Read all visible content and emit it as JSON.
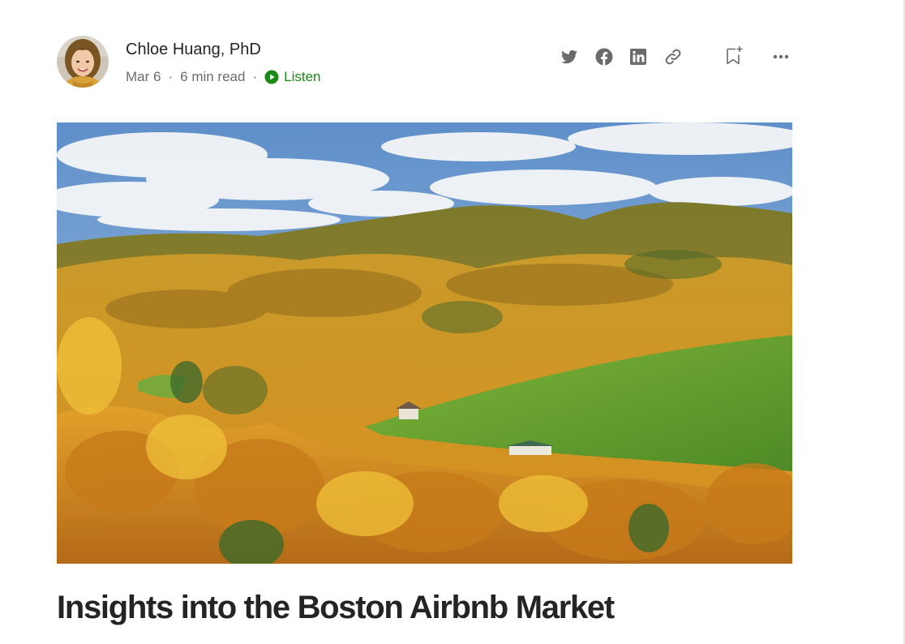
{
  "author": {
    "name": "Chloe Huang, PhD",
    "avatar_icon": "profile-photo"
  },
  "meta": {
    "date": "Mar 6",
    "separator": "·",
    "read_time": "6 min read",
    "listen_label": "Listen",
    "listen_icon": "play-circle-icon"
  },
  "share": {
    "icons": [
      "twitter-icon",
      "facebook-icon",
      "linkedin-icon",
      "link-icon"
    ]
  },
  "toolbar": {
    "bookmark_icon": "bookmark-add-icon",
    "more_icon": "more-horizontal-icon"
  },
  "hero": {
    "image_icon": "autumn-landscape-photo"
  },
  "article": {
    "title": "Insights into the Boston Airbnb Market"
  },
  "colors": {
    "text": "#242424",
    "meta": "#6b6b6b",
    "listen_green": "#1a8917",
    "icon_gray": "#6b6b6b"
  }
}
